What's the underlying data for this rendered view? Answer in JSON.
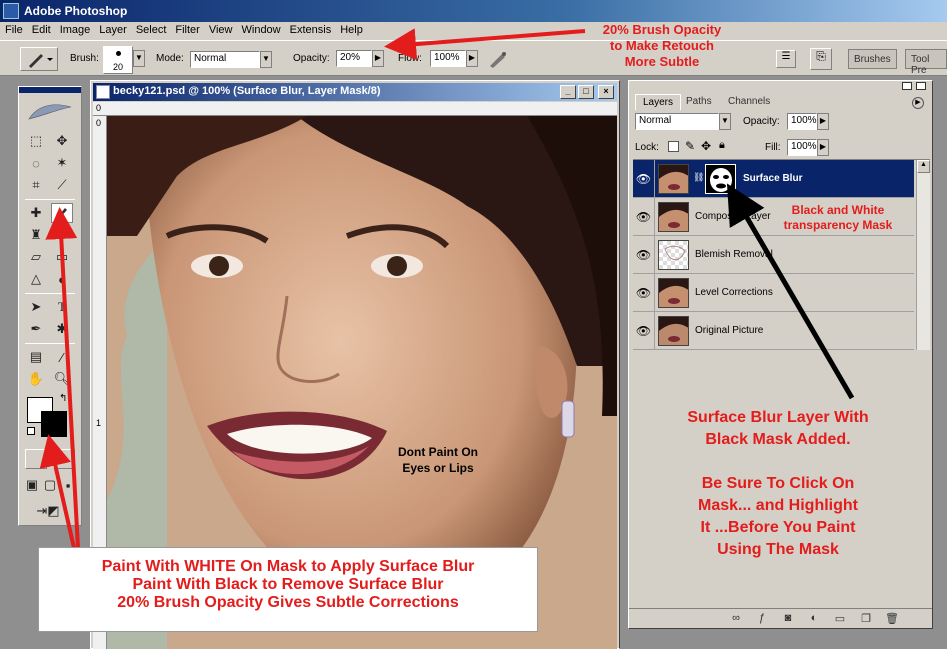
{
  "window": {
    "title": "Adobe Photoshop"
  },
  "menu": [
    "File",
    "Edit",
    "Image",
    "Layer",
    "Select",
    "Filter",
    "View",
    "Window",
    "Extensis",
    "Help"
  ],
  "options_bar": {
    "brush_label": "Brush:",
    "brush_size": "20",
    "mode_label": "Mode:",
    "mode_value": "Normal",
    "opacity_label": "Opacity:",
    "opacity_value": "20%",
    "flow_label": "Flow:",
    "flow_value": "100%",
    "tabs": [
      "Brushes",
      "Tool Pre"
    ]
  },
  "document": {
    "title": "becky121.psd @ 100% (Surface Blur, Layer Mask/8)",
    "ruler_top_0": "0",
    "ruler_left_0": "0",
    "ruler_left_1": "1"
  },
  "layers_palette": {
    "tabs": [
      "Layers",
      "Paths",
      "Channels"
    ],
    "blend_mode": "Normal",
    "opacity_label": "Opacity:",
    "opacity_value": "100%",
    "lock_label": "Lock:",
    "fill_label": "Fill:",
    "fill_value": "100%",
    "layers": [
      {
        "name": "Surface Blur",
        "selected": true
      },
      {
        "name": "Composite Layer",
        "selected": false
      },
      {
        "name": "Blemish Removal",
        "selected": false
      },
      {
        "name": "Level Corrections",
        "selected": false
      },
      {
        "name": "Original Picture",
        "selected": false
      }
    ]
  },
  "annotations": {
    "opacity_note": [
      "20% Brush Opacity",
      "to Make Retouch",
      "More Subtle"
    ],
    "mask_note": [
      "Black and White",
      "transparency Mask"
    ],
    "layer_note": [
      "Surface Blur Layer With",
      "Black Mask Added.",
      "",
      "Be Sure To Click On",
      "Mask... and Highlight",
      "It ...Before You Paint",
      "Using The Mask"
    ],
    "canvas_note": [
      "Dont Paint On",
      "Eyes or Lips"
    ],
    "callout": [
      "Paint With WHITE On Mask to Apply Surface Blur",
      "Paint With Black to Remove Surface Blur",
      "20% Brush Opacity Gives Subtle Corrections"
    ]
  },
  "colors": {
    "annotation_red": "#e31c1c",
    "title_blue": "#0a246a",
    "panel_gray": "#d4d0c8"
  },
  "icons": [
    "feather-icon",
    "brush-icon",
    "eye-icon",
    "lock-icon",
    "chain-link-icon"
  ]
}
